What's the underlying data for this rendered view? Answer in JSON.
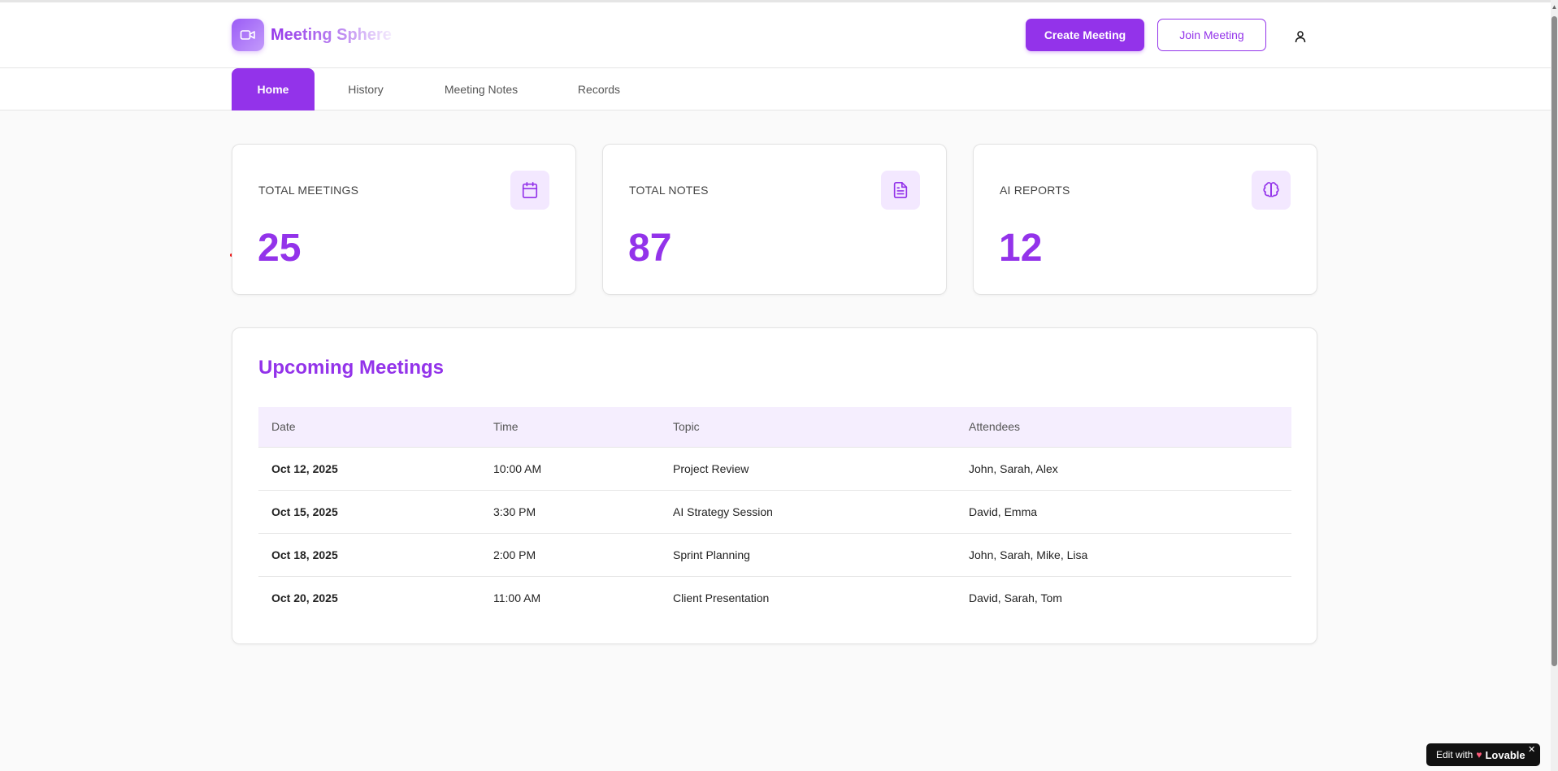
{
  "app": {
    "name": "Meeting Sphere"
  },
  "header": {
    "create_label": "Create Meeting",
    "join_label": "Join Meeting"
  },
  "tabs": [
    {
      "label": "Home",
      "active": true
    },
    {
      "label": "History",
      "active": false
    },
    {
      "label": "Meeting Notes",
      "active": false
    },
    {
      "label": "Records",
      "active": false
    }
  ],
  "stats": [
    {
      "label": "TOTAL MEETINGS",
      "value": "25",
      "icon": "calendar-icon"
    },
    {
      "label": "TOTAL NOTES",
      "value": "87",
      "icon": "document-icon"
    },
    {
      "label": "AI REPORTS",
      "value": "12",
      "icon": "brain-icon"
    }
  ],
  "upcoming": {
    "title": "Upcoming Meetings",
    "columns": [
      "Date",
      "Time",
      "Topic",
      "Attendees"
    ],
    "rows": [
      {
        "date": "Oct 12, 2025",
        "time": "10:00 AM",
        "topic": "Project Review",
        "attendees": "John, Sarah, Alex"
      },
      {
        "date": "Oct 15, 2025",
        "time": "3:30 PM",
        "topic": "AI Strategy Session",
        "attendees": "David, Emma"
      },
      {
        "date": "Oct 18, 2025",
        "time": "2:00 PM",
        "topic": "Sprint Planning",
        "attendees": "John, Sarah, Mike, Lisa"
      },
      {
        "date": "Oct 20, 2025",
        "time": "11:00 AM",
        "topic": "Client Presentation",
        "attendees": "David, Sarah, Tom"
      }
    ]
  },
  "badge": {
    "prefix": "Edit with",
    "brand": "Lovable"
  },
  "colors": {
    "accent": "#9333ea",
    "accent_light": "#f3e8ff",
    "background": "#fafafa"
  }
}
